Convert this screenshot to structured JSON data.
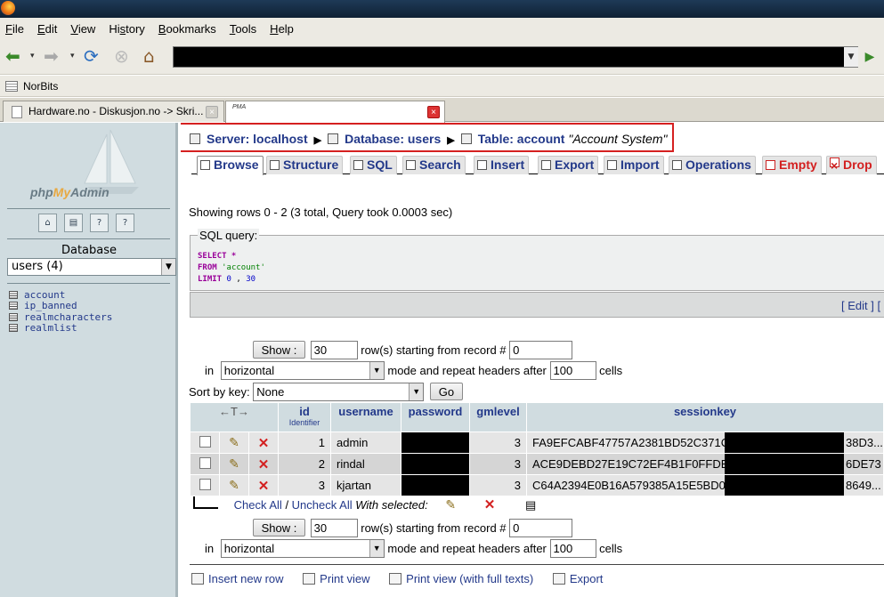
{
  "browser": {
    "menu": [
      "File",
      "Edit",
      "View",
      "History",
      "Bookmarks",
      "Tools",
      "Help"
    ],
    "menu_underline": [
      "F",
      "E",
      "V",
      "s",
      "B",
      "T",
      "H"
    ],
    "bookmark": "NorBits",
    "tabs": [
      {
        "title": "Hardware.no - Diskusjon.no -> Skri..."
      },
      {
        "title": "",
        "icon_text": "PMA"
      }
    ]
  },
  "sidebar": {
    "logo_prefix": "php",
    "logo_accent": "My",
    "logo_suffix": "Admin",
    "database_label": "Database",
    "database_selected": "users (4)",
    "tables": [
      "account",
      "ip_banned",
      "realmcharacters",
      "realmlist"
    ]
  },
  "breadcrumb": {
    "server": "Server: localhost",
    "database": "Database: users",
    "table": "Table: account",
    "comment": "\"Account System\""
  },
  "tabs": [
    "Browse",
    "Structure",
    "SQL",
    "Search",
    "Insert",
    "Export",
    "Import",
    "Operations",
    "Empty",
    "Drop"
  ],
  "status": "Showing rows 0 - 2 (3 total, Query took 0.0003 sec)",
  "sql": {
    "legend": "SQL query:",
    "select_kw": "SELECT",
    "select_rest": " *",
    "from_kw": "FROM",
    "from_table": " 'account'",
    "limit_kw": "LIMIT",
    "limit_a": " 0",
    "limit_sep": " , ",
    "limit_b": "30",
    "edit": "[ Edit ] ["
  },
  "controls": {
    "show_label": "Show :",
    "rows_value": "30",
    "rows_text": "row(s) starting from record #",
    "start_value": "0",
    "in_text": "in",
    "mode_value": "horizontal",
    "mode_text": "mode and repeat headers after",
    "repeat_value": "100",
    "cells_text": "cells",
    "sort_label": "Sort by key:",
    "sort_value": "None",
    "go_label": "Go"
  },
  "table": {
    "nav_arrows": "←T→",
    "columns": [
      {
        "name": "id",
        "sub": "Identifier"
      },
      {
        "name": "username",
        "sub": ""
      },
      {
        "name": "password",
        "sub": ""
      },
      {
        "name": "gmlevel",
        "sub": ""
      },
      {
        "name": "sessionkey",
        "sub": ""
      }
    ],
    "rows": [
      {
        "id": "1",
        "username": "admin",
        "gmlevel": "3",
        "sessionkey": "FA9EFCABF47757A2381BD52C371C9",
        "tail": "38D3..."
      },
      {
        "id": "2",
        "username": "rindal",
        "gmlevel": "3",
        "sessionkey": "ACE9DEBD27E19C72EF4B1F0FFDB4",
        "tail": "6DE73"
      },
      {
        "id": "3",
        "username": "kjartan",
        "gmlevel": "3",
        "sessionkey": "C64A2394E0B16A579385A15E5BD0F",
        "tail": "8649..."
      }
    ]
  },
  "check": {
    "check_all": "Check All",
    "slash": " / ",
    "uncheck_all": "Uncheck All",
    "with_selected": "With selected:"
  },
  "bottom": {
    "insert": "Insert new row",
    "print": "Print view",
    "print_full": "Print view (with full texts)",
    "export": "Export"
  }
}
